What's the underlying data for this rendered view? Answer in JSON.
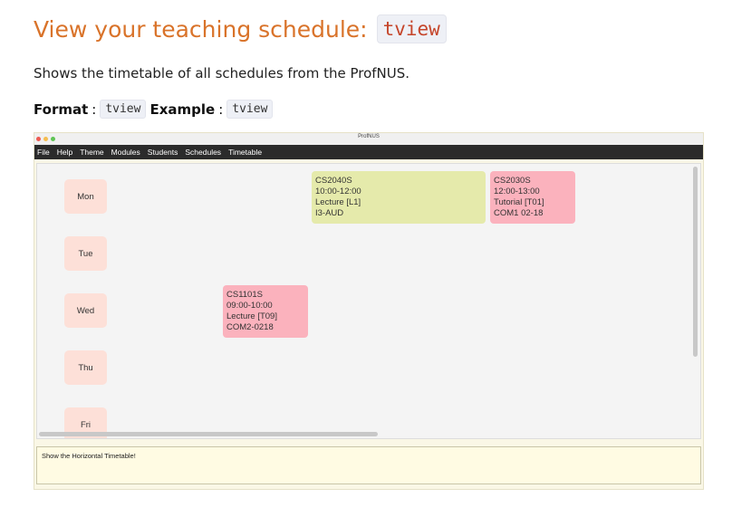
{
  "heading": {
    "text": "View your teaching schedule:",
    "code": "tview"
  },
  "description": "Shows the timetable of all schedules from the ProfNUS.",
  "format": {
    "format_label": "Format",
    "format_code": "tview",
    "example_label": "Example",
    "example_code": "tview"
  },
  "app": {
    "window_title": "ProfNUS",
    "menu": [
      "File",
      "Help",
      "Theme",
      "Modules",
      "Students",
      "Schedules",
      "Timetable"
    ],
    "days": [
      "Mon",
      "Tue",
      "Wed",
      "Thu",
      "Fri"
    ],
    "lessons": [
      {
        "lines": [
          "CS2040S",
          "10:00-12:00",
          "Lecture  [L1]",
          "I3-AUD"
        ],
        "color": "#e5eaab"
      },
      {
        "lines": [
          "CS2030S",
          "12:00-13:00",
          "Tutorial  [T01]",
          "COM1 02-18"
        ],
        "color": "#fbb2bd"
      },
      {
        "lines": [
          "CS1101S",
          "09:00-10:00",
          "Lecture  [T09]",
          "COM2-0218"
        ],
        "color": "#fbb2bd"
      }
    ],
    "result_text": "Show the Horizontal Timetable!",
    "colors": {
      "menubar": "#2b2b2b",
      "day_chip": "#fde0d8",
      "close": "#ee5a52",
      "minimize": "#f5bd4f",
      "zoom": "#5fc454"
    }
  }
}
